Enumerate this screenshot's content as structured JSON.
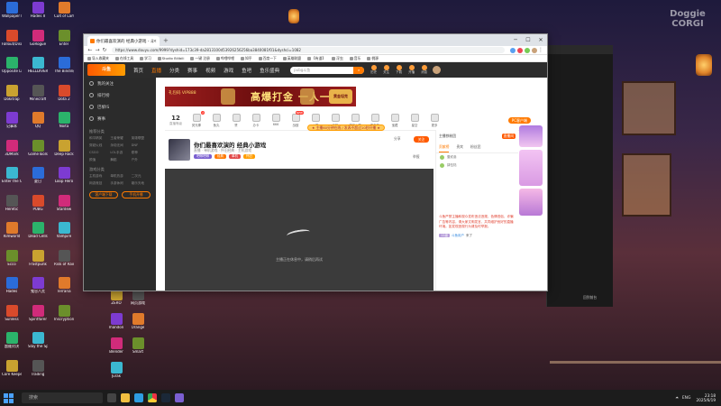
{
  "desktop": {
    "watermark": "Doggie\nCORGI",
    "icons_left": [
      "Wallpaper Engine",
      "Fallout/Disc",
      "Opposite Light",
      "Dokitrap",
      "记事本",
      "3DMark",
      "Enter the Gungeon",
      "Heretic",
      "Rimworld",
      "Ecco",
      "Hades",
      "Sunless",
      "超维对决",
      "Core Keeper",
      "Hades II",
      "GoRogue",
      "HELLDIVERS",
      "Minecraft",
      "QQ",
      "GameTools",
      "夏日",
      "PUBG",
      "Dead Cells",
      "Frostpunk",
      "鬼谷八荒",
      "Spiritfarer",
      "Slay the Spire",
      "Trading",
      "Cult of Lamb",
      "Enter",
      "The Binding",
      "Dota 2",
      "Noita",
      "Deep Rock",
      "Loop Hero",
      "Stardew",
      "Vampire",
      "Risk of Rain",
      "Terraria",
      "Inscryption"
    ],
    "icons_col3": [
      "ZERO",
      "mandon",
      "Blender",
      "Jurak",
      "网页游戏",
      "Orange",
      "Smart"
    ]
  },
  "browser": {
    "tab_title": "你们最喜欢演的 经典小游戏 - 斗鱼",
    "url": "https://www.douyu.com/9999?dyshid=173c39-da2813100d53926256256ba3840081f01&dyshci=1082",
    "bookmarks": [
      "导入收藏夹",
      "在线工具",
      "学习",
      "Studio Bilibili",
      "一键 注册",
      "哔哩哔哩",
      "知乎",
      "百度一下",
      "英雄联盟",
      "【有道】",
      "浮虫",
      "音乐",
      "桃源"
    ],
    "window_controls": [
      "─",
      "☐",
      "✕"
    ]
  },
  "site": {
    "logo": "斗鱼",
    "nav": [
      "首页",
      "直播",
      "分类",
      "赛事",
      "视频",
      "游戏",
      "鱼吧",
      "鱼乐盛典"
    ],
    "nav_active_index": 1,
    "search_placeholder": "pubg斗鱼",
    "header_icons": [
      "历史",
      "关注",
      "下载",
      "开播",
      "消息"
    ],
    "sidebar_top": [
      "我的关注",
      "排行榜",
      "巴黎IS",
      "赛事"
    ],
    "sidebar_section1": "推荐分类",
    "sidebar_grid1": [
      "和平精英",
      "王者荣耀",
      "英雄联盟",
      "穿越火线",
      "永劫无间",
      "DNF",
      "CSGO",
      "LOL手游",
      "原神",
      "颜值",
      "舞蹈",
      "户外"
    ],
    "sidebar_section2": "游戏分类",
    "sidebar_grid2": [
      "主机游戏",
      "单机热游",
      "二次元",
      "网游竞技",
      "手游休闲",
      "娱乐天地"
    ],
    "sidebar_buttons": [
      "客户端下载",
      "手机开播"
    ],
    "banner": {
      "left": "礼包码 VIP888",
      "main": "高爆打金 一人一鬼服",
      "badge": "黄金坦克"
    },
    "level": {
      "number": "12",
      "label": "直播等级"
    },
    "gifts": [
      "荧光棒",
      "鱼丸",
      "赞",
      "办卡",
      "666",
      "战鼓",
      "火箭",
      "飞机",
      "超级火箭",
      "嘉年华",
      "宝藏",
      "星空",
      "更多"
    ],
    "gift_badges": [
      "1",
      "",
      "",
      "",
      "",
      "NEW",
      "",
      "",
      "",
      "",
      "",
      "",
      ""
    ],
    "pc_button": "PC客户端",
    "notice": "★ 主播60分钟在线 / 发表不超过10秒开播 ★",
    "stream": {
      "title": "你们最喜欢演的 经典小游戏",
      "meta": "直播 · 单机游戏 · 怀旧经典 · 主机游戏",
      "tags": [
        "吧唧吧唧",
        "经典",
        "单机",
        "怀旧"
      ],
      "follow": "关注",
      "share": "分享",
      "report": "举报"
    },
    "player_msg": "主播正在休息中，请稍后再试",
    "chat": {
      "streamer": "主播铁粉团",
      "live_badge": "直播间",
      "tabs": [
        "贡献榜",
        "贵宾",
        "粉丝团"
      ],
      "ranks": [
        "壹贰叁",
        "肆伍陆"
      ],
      "system_msg": "斗鱼严禁主播和观众发布违法违规、色情低俗、诈骗广告等内容，请大家文明发言，共同维护良好的直播环境。如发现违规行为请及时举报。",
      "msg_badge": "12级",
      "msg_user": "斗鱼用户",
      "msg_text": "来了"
    }
  },
  "taskbar": {
    "search_placeholder": "搜索",
    "tray": [
      "ENG",
      "⏶"
    ],
    "time": "23:18",
    "date": "2025/6/19"
  },
  "player_panel": {
    "button": "回到前台"
  }
}
